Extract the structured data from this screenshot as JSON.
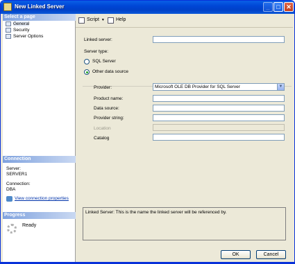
{
  "window": {
    "title": "New Linked Server"
  },
  "left": {
    "select_page_header": "Select a page",
    "pages": [
      {
        "label": "General",
        "selected": true
      },
      {
        "label": "Security",
        "selected": false
      },
      {
        "label": "Server Options",
        "selected": false
      }
    ],
    "connection_header": "Connection",
    "server_label": "Server:",
    "server_value": "SERVER1",
    "connection_label": "Connection:",
    "connection_value": "DBA",
    "view_connection_link": "View connection properties",
    "progress_header": "Progress",
    "progress_status": "Ready"
  },
  "toolbar": {
    "script_label": "Script",
    "help_label": "Help"
  },
  "form": {
    "linked_server_label": "Linked server:",
    "linked_server_value": "",
    "server_type_label": "Server type:",
    "sql_server_label": "SQL Server",
    "other_source_label": "Other data source",
    "selected_server_type": "Other data source",
    "provider_label": "Provider:",
    "provider_value": "Microsoft OLE DB Provider for SQL Server",
    "product_name_label": "Product name:",
    "data_source_label": "Data source:",
    "provider_string_label": "Provider string:",
    "location_label": "Location",
    "catalog_label": "Catalog"
  },
  "description": "Linked Server: This is the name the linked server will be referenced by.",
  "buttons": {
    "ok": "OK",
    "cancel": "Cancel"
  }
}
